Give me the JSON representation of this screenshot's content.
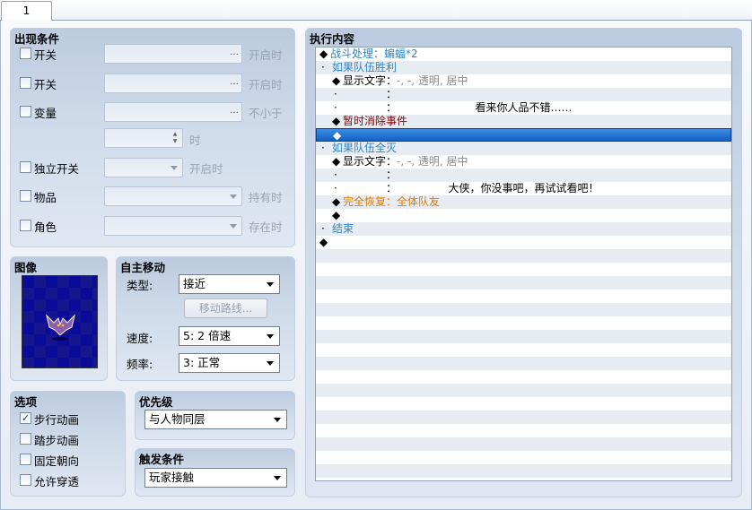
{
  "tab": {
    "label": "1"
  },
  "conditions": {
    "title": "出现条件",
    "items": [
      {
        "label": "开关",
        "value": "",
        "suffix": "开启时"
      },
      {
        "label": "开关",
        "value": "",
        "suffix": "开启时"
      },
      {
        "label": "变量",
        "value": "",
        "suffix": "不小于"
      },
      {
        "label": "",
        "value": "",
        "suffix": "时"
      },
      {
        "label": "独立开关",
        "value": "",
        "suffix": "开启时"
      },
      {
        "label": "物品",
        "value": "",
        "suffix": "持有时"
      },
      {
        "label": "角色",
        "value": "",
        "suffix": "存在时"
      }
    ],
    "dots": "…"
  },
  "image": {
    "title": "图像"
  },
  "autonomous": {
    "title": "自主移动",
    "type_label": "类型:",
    "type_value": "接近",
    "route_button": "移动路线...",
    "speed_label": "速度:",
    "speed_value": "5: 2 倍速",
    "freq_label": "频率:",
    "freq_value": "3: 正常"
  },
  "options": {
    "title": "选项",
    "items": [
      {
        "label": "步行动画",
        "checked": true
      },
      {
        "label": "踏步动画",
        "checked": false
      },
      {
        "label": "固定朝向",
        "checked": false
      },
      {
        "label": "允许穿透",
        "checked": false
      }
    ],
    "check_mark": "✓"
  },
  "priority": {
    "title": "优先级",
    "value": "与人物同层"
  },
  "trigger": {
    "title": "触发条件",
    "value": "玩家接触"
  },
  "execution": {
    "title": "执行内容",
    "lines": [
      {
        "prefix": "◆",
        "text": "战斗处理：蝙蝠*2",
        "color": "#2e86c1",
        "indent": 4
      },
      {
        "prefix": "·",
        "text": "如果队伍胜利",
        "color": "#2e86c1",
        "indent": 6
      },
      {
        "prefix": "◆",
        "text": "显示文字：",
        "color": "#000000",
        "indent": 18,
        "extra": "-, -, 透明, 居中",
        "extra_color": "#8a8a8a"
      },
      {
        "prefix": "·",
        "text": "",
        "color": "#000000",
        "indent": 20,
        "colon": "："
      },
      {
        "prefix": "·",
        "text": "",
        "color": "#000000",
        "indent": 20,
        "colon": "：",
        "center": "看来你人品不错……"
      },
      {
        "prefix": "◆",
        "text": "暂时消除事件",
        "color": "#8b0000",
        "indent": 18
      },
      {
        "prefix": "◆",
        "text": "",
        "color": "#ffffff",
        "indent": 18,
        "selected": true
      },
      {
        "prefix": "·",
        "text": "如果队伍全灭",
        "color": "#2e86c1",
        "indent": 6
      },
      {
        "prefix": "◆",
        "text": "显示文字：",
        "color": "#000000",
        "indent": 18,
        "extra": "-, -, 透明, 居中",
        "extra_color": "#8a8a8a"
      },
      {
        "prefix": "·",
        "text": "",
        "color": "#000000",
        "indent": 20,
        "colon": "："
      },
      {
        "prefix": "·",
        "text": "",
        "color": "#000000",
        "indent": 20,
        "colon": "：",
        "center": "大侠，你没事吧，再试试看吧！"
      },
      {
        "prefix": "◆",
        "text": "完全恢复：全体队友",
        "color": "#e07b00",
        "indent": 18
      },
      {
        "prefix": "◆",
        "text": "",
        "color": "#000000",
        "indent": 18
      },
      {
        "prefix": "·",
        "text": "结束",
        "color": "#2e86c1",
        "indent": 6
      },
      {
        "prefix": "◆",
        "text": "",
        "color": "#000000",
        "indent": 4
      }
    ]
  },
  "colors": {
    "accent": "#0f62c8",
    "command": "#2e86c1",
    "erase": "#8b0000",
    "recover": "#e07b00"
  }
}
